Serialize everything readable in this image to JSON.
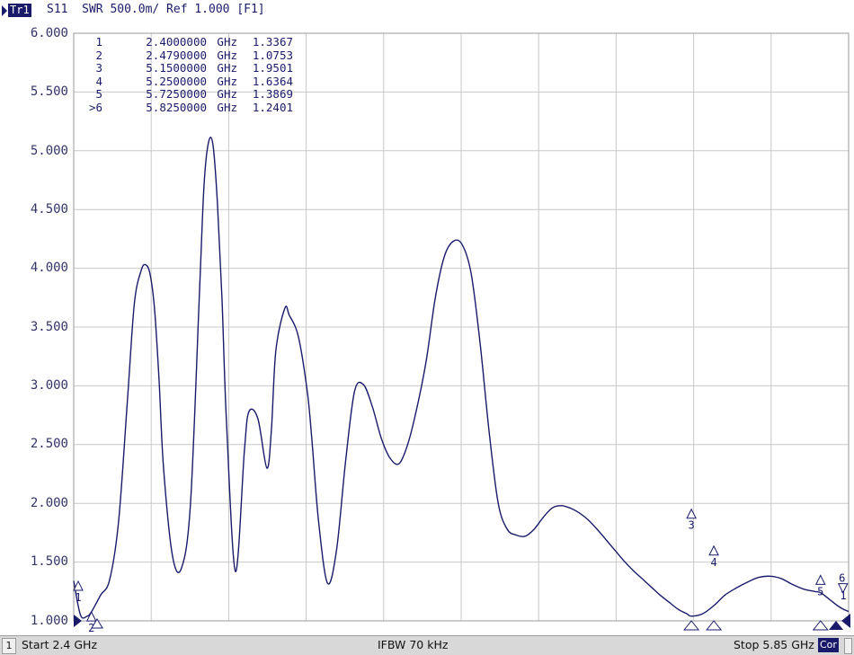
{
  "header": {
    "trace_tag": "Tr1",
    "trace_desc": "S11  SWR 500.0m/ Ref 1.000 [F1]"
  },
  "status": {
    "channel": "1",
    "start": "Start 2.4 GHz",
    "ifbw": "IFBW 70 kHz",
    "stop": "Stop 5.85 GHz",
    "cor": "Cor"
  },
  "markers_table": [
    {
      "idx": "1",
      "freq": "2.4000000",
      "unit": "GHz",
      "value": "1.3367"
    },
    {
      "idx": "2",
      "freq": "2.4790000",
      "unit": "GHz",
      "value": "1.0753"
    },
    {
      "idx": "3",
      "freq": "5.1500000",
      "unit": "GHz",
      "value": "1.9501"
    },
    {
      "idx": "4",
      "freq": "5.2500000",
      "unit": "GHz",
      "value": "1.6364"
    },
    {
      "idx": "5",
      "freq": "5.7250000",
      "unit": "GHz",
      "value": "1.3869"
    },
    {
      "idx": ">6",
      "freq": "5.8250000",
      "unit": "GHz",
      "value": "1.2401"
    }
  ],
  "colors": {
    "trace": "#1a1a6a",
    "grid": "#c8c8c8",
    "background": "#ffffff",
    "marker_fill": "#1a1a6a"
  },
  "chart_data": {
    "type": "line",
    "title": "",
    "xlabel": "",
    "ylabel": "",
    "xlim": [
      2.4,
      5.85
    ],
    "ylim": [
      1.0,
      6.0
    ],
    "yticks": [
      "6.000",
      "5.500",
      "5.000",
      "4.500",
      "4.000",
      "3.500",
      "3.000",
      "2.500",
      "2.000",
      "1.500",
      "1.000"
    ],
    "grid": true,
    "series": [
      {
        "x": [
          2.4,
          2.43,
          2.46,
          2.48,
          2.52,
          2.56,
          2.6,
          2.64,
          2.67,
          2.7,
          2.72,
          2.74,
          2.76,
          2.78,
          2.8,
          2.84,
          2.88,
          2.92,
          2.96,
          2.98,
          3.0,
          3.02,
          3.04,
          3.06,
          3.08,
          3.12,
          3.16,
          3.18,
          3.22,
          3.26,
          3.28,
          3.3,
          3.34,
          3.36,
          3.4,
          3.44,
          3.46,
          3.49,
          3.53,
          3.57,
          3.61,
          3.65,
          3.69,
          3.73,
          3.77,
          3.81,
          3.85,
          3.89,
          3.93,
          3.97,
          4.01,
          4.05,
          4.09,
          4.13,
          4.17,
          4.21,
          4.25,
          4.29,
          4.33,
          4.37,
          4.41,
          4.45,
          4.49,
          4.53,
          4.57,
          4.61,
          4.65,
          4.69,
          4.73,
          4.77,
          4.81,
          4.85,
          4.89,
          4.93,
          4.97,
          5.01,
          5.05,
          5.09,
          5.13,
          5.15,
          5.2,
          5.25,
          5.3,
          5.35,
          5.4,
          5.45,
          5.5,
          5.55,
          5.6,
          5.65,
          5.7,
          5.725,
          5.76,
          5.8,
          5.825,
          5.85
        ],
        "y": [
          1.34,
          1.05,
          1.04,
          1.08,
          1.22,
          1.35,
          1.85,
          2.9,
          3.7,
          3.98,
          4.03,
          3.95,
          3.65,
          3.05,
          2.3,
          1.55,
          1.45,
          2.0,
          3.8,
          4.7,
          5.07,
          5.05,
          4.55,
          3.75,
          2.7,
          1.42,
          2.45,
          2.78,
          2.72,
          2.3,
          2.62,
          3.3,
          3.66,
          3.6,
          3.42,
          2.95,
          2.55,
          1.85,
          1.32,
          1.6,
          2.35,
          2.95,
          3.01,
          2.82,
          2.55,
          2.38,
          2.34,
          2.52,
          2.83,
          3.22,
          3.75,
          4.1,
          4.23,
          4.2,
          3.95,
          3.35,
          2.6,
          2.0,
          1.78,
          1.73,
          1.72,
          1.78,
          1.88,
          1.96,
          1.98,
          1.96,
          1.92,
          1.86,
          1.78,
          1.69,
          1.6,
          1.51,
          1.43,
          1.36,
          1.29,
          1.22,
          1.16,
          1.1,
          1.06,
          1.04,
          1.06,
          1.13,
          1.22,
          1.28,
          1.33,
          1.37,
          1.38,
          1.36,
          1.31,
          1.27,
          1.25,
          1.24,
          1.19,
          1.13,
          1.1,
          1.08
        ]
      }
    ],
    "markers": [
      {
        "label": "1",
        "x": 2.4,
        "y": 1.3367
      },
      {
        "label": "2",
        "x": 2.479,
        "y": 1.0753
      },
      {
        "label": "3",
        "x": 5.15,
        "y": 1.9501
      },
      {
        "label": "4",
        "x": 5.25,
        "y": 1.6364
      },
      {
        "label": "5",
        "x": 5.725,
        "y": 1.3869
      },
      {
        "label": "6",
        "x": 5.825,
        "y": 1.2401
      }
    ]
  }
}
